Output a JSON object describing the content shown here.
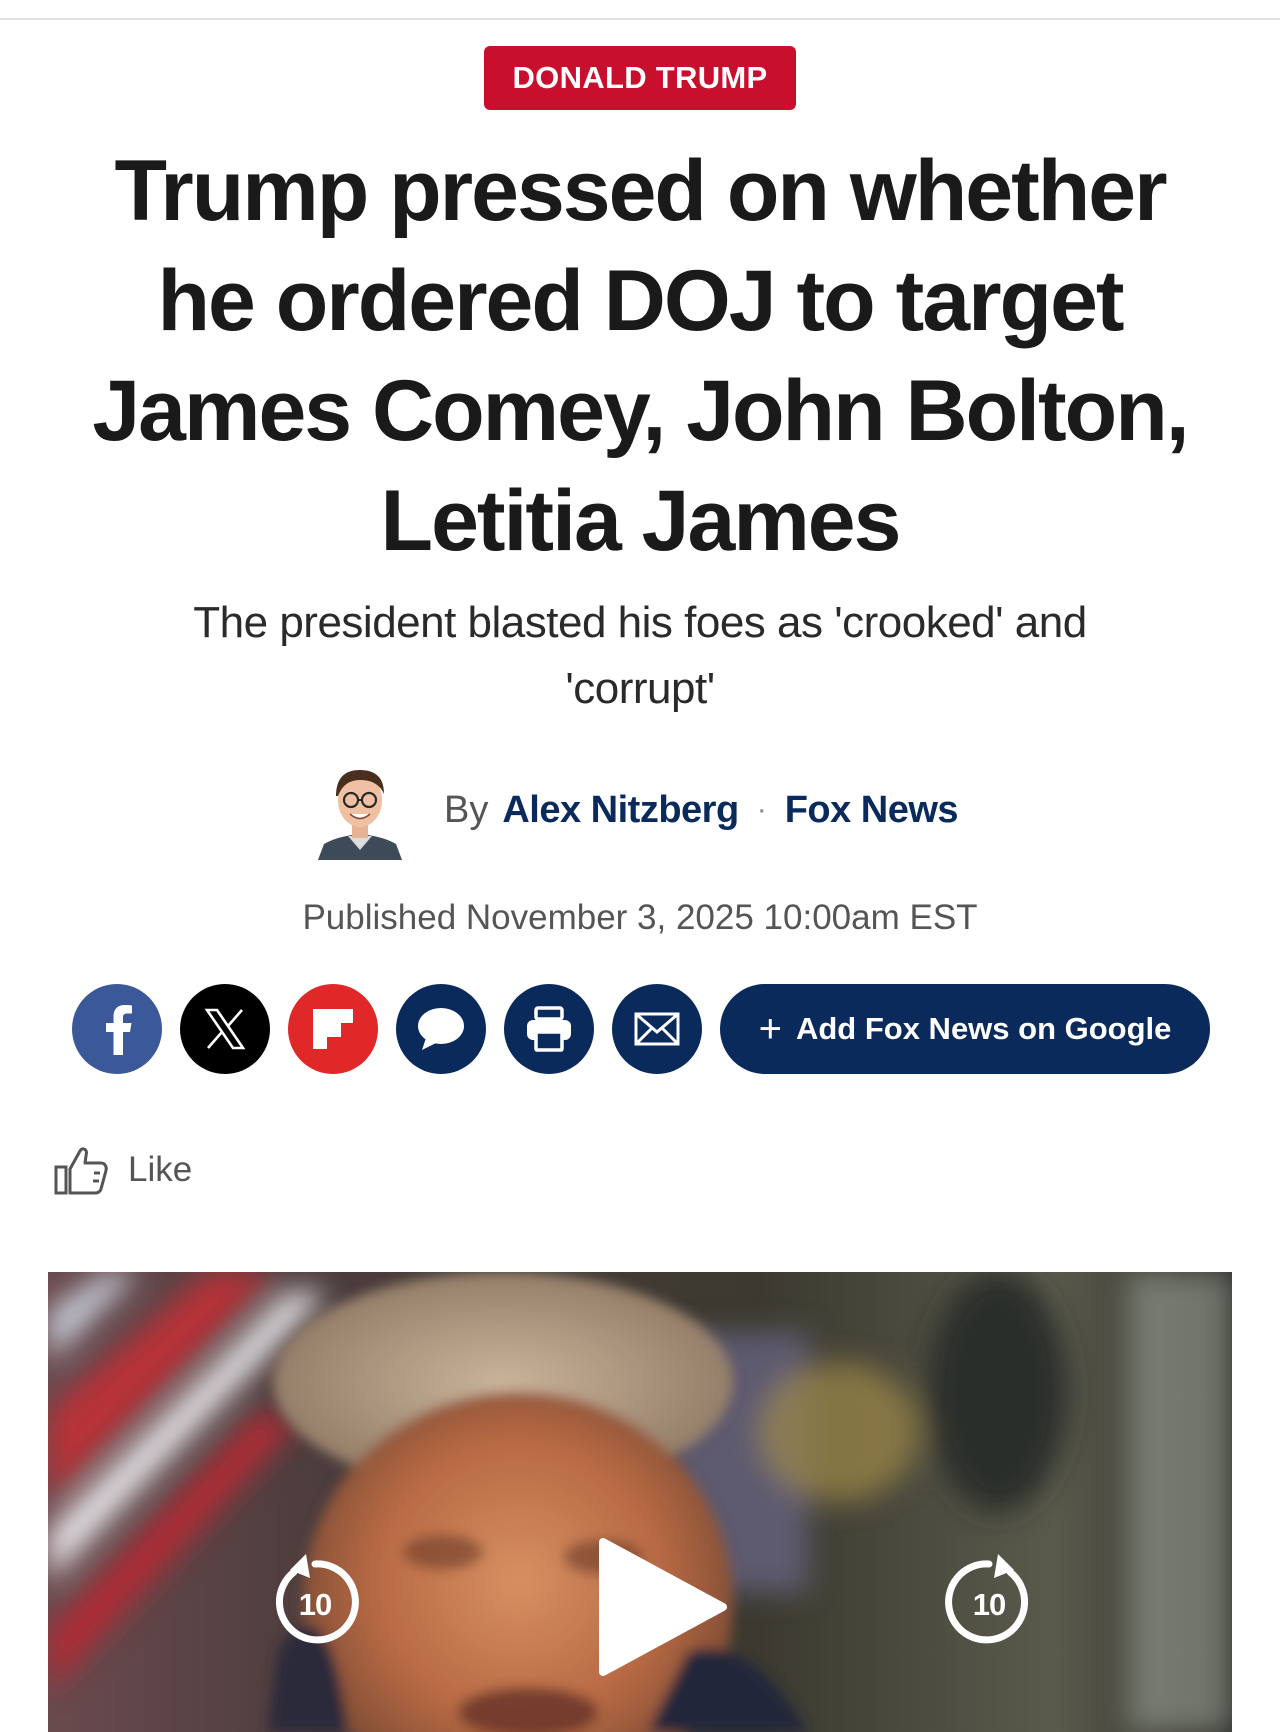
{
  "article": {
    "category": "DONALD TRUMP",
    "headline": "Trump pressed on whether he ordered DOJ to target James Comey, John Bolton, Letitia James",
    "subheadline": "The president blasted his foes as 'crooked' and 'corrupt'",
    "byline": {
      "prefix": "By",
      "author": "Alex Nitzberg",
      "separator": "·",
      "source": "Fox News"
    },
    "published": "Published November 3, 2025 10:00am EST"
  },
  "share": {
    "buttons": [
      {
        "name": "facebook",
        "icon": "facebook-icon"
      },
      {
        "name": "x",
        "icon": "x-icon"
      },
      {
        "name": "flipboard",
        "icon": "flipboard-icon"
      },
      {
        "name": "comments",
        "icon": "comment-icon"
      },
      {
        "name": "print",
        "icon": "print-icon"
      },
      {
        "name": "email",
        "icon": "email-icon"
      }
    ],
    "google_button": {
      "plus": "+",
      "label": "Add Fox News on Google"
    }
  },
  "like": {
    "label": "Like",
    "icon": "thumbs-up-icon"
  },
  "video": {
    "rewind_seconds": "10",
    "forward_seconds": "10",
    "play_icon": "play-icon"
  },
  "colors": {
    "category_badge": "#c8102e",
    "fox_navy": "#0a2a5c",
    "facebook": "#3b5998",
    "x": "#000000",
    "flipboard": "#e12828",
    "headline_text": "#1a1a1a",
    "meta_text": "#555555"
  }
}
